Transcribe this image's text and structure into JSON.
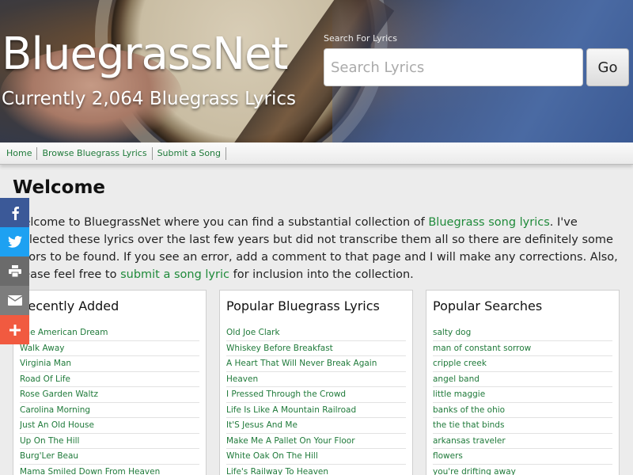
{
  "header": {
    "title": "BluegrassNet",
    "subtitle": "Currently 2,064 Bluegrass Lyrics",
    "search_label": "Search For Lyrics",
    "search_placeholder": "Search Lyrics",
    "search_value": "",
    "go_label": "Go"
  },
  "nav": {
    "items": [
      "Home",
      "Browse Bluegrass Lyrics",
      "Submit a Song"
    ]
  },
  "welcome": {
    "title": "Welcome",
    "text1": "Welcome to BluegrassNet where you can find a substantial collection of ",
    "link1": "Bluegrass song lyrics",
    "text2": ". I've collected these lyrics over the last few years but did not transcribe them all so there are definitely some errors to be found. If you see an error, add a comment to that page and I will make any corrections. Also, please feel free to ",
    "link2": "submit a song lyric",
    "text3": " for inclusion into the collection."
  },
  "panels": [
    {
      "title": "Recently Added",
      "items": [
        "The American Dream",
        "Walk Away",
        "Virginia Man",
        "Road Of Life",
        "Rose Garden Waltz",
        "Carolina Morning",
        "Just An Old House",
        "Up On The Hill",
        "Burg'Ler Beau",
        "Mama Smiled Down From Heaven"
      ]
    },
    {
      "title": "Popular Bluegrass Lyrics",
      "items": [
        "Old Joe Clark",
        "Whiskey Before Breakfast",
        "A Heart That Will Never Break Again",
        "Heaven",
        "I Pressed Through the Crowd",
        "Life Is Like A Mountain Railroad",
        "It'S Jesus And Me",
        "Make Me A Pallet On Your Floor",
        "White Oak On The Hill",
        "Life's Railway To Heaven"
      ]
    },
    {
      "title": "Popular Searches",
      "items": [
        "salty dog",
        "man of constant sorrow",
        "cripple creek",
        "angel band",
        "little maggie",
        "banks of the ohio",
        "the tie that binds",
        "arkansas traveler",
        "flowers",
        "you're drifting away"
      ]
    }
  ],
  "share": {
    "buttons": [
      {
        "icon": "facebook-icon",
        "glyph": "f",
        "color": "#3b5998"
      },
      {
        "icon": "twitter-icon",
        "glyph": "t",
        "color": "#1da1f2"
      },
      {
        "icon": "print-icon",
        "glyph": "⎙",
        "color": "#6b6b6b"
      },
      {
        "icon": "email-icon",
        "glyph": "✉",
        "color": "#7d7d7d"
      },
      {
        "icon": "more-icon",
        "glyph": "+",
        "color": "#f15a40"
      }
    ]
  }
}
